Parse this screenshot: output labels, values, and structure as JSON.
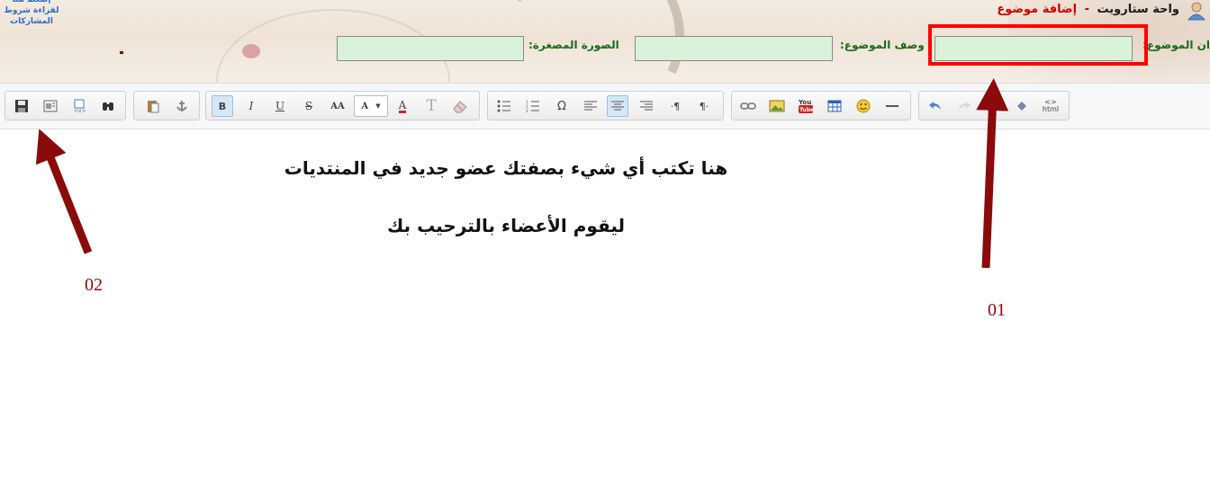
{
  "header": {
    "left_note": "إضغط هنا لقراءة شروط المشاركات",
    "forum_name": "واحة ستارويت",
    "separator": "-",
    "action": "إضافة موضوع"
  },
  "form": {
    "title_label": "ان الموضوع:",
    "description_label": "وصف الموضوع:",
    "thumbnail_label": "الصورة المصغرة:",
    "title_value": "",
    "description_value": "",
    "thumbnail_value": ""
  },
  "editor": {
    "line1": "هنا تكتب أي شيء بصفتك عضو جديد في المنتديات",
    "line2": "ليقوم الأعضاء بالترحيب بك"
  },
  "annotations": {
    "label1": "01",
    "label2": "02",
    "color": "#8b0a0a"
  },
  "toolbar": {
    "bold": "B",
    "italic": "I",
    "underline": "U",
    "strike": "S",
    "font_size": "AA",
    "font_face": "A",
    "font_color": "A",
    "text_style": "T",
    "special_char": "Ω",
    "html": "html"
  }
}
